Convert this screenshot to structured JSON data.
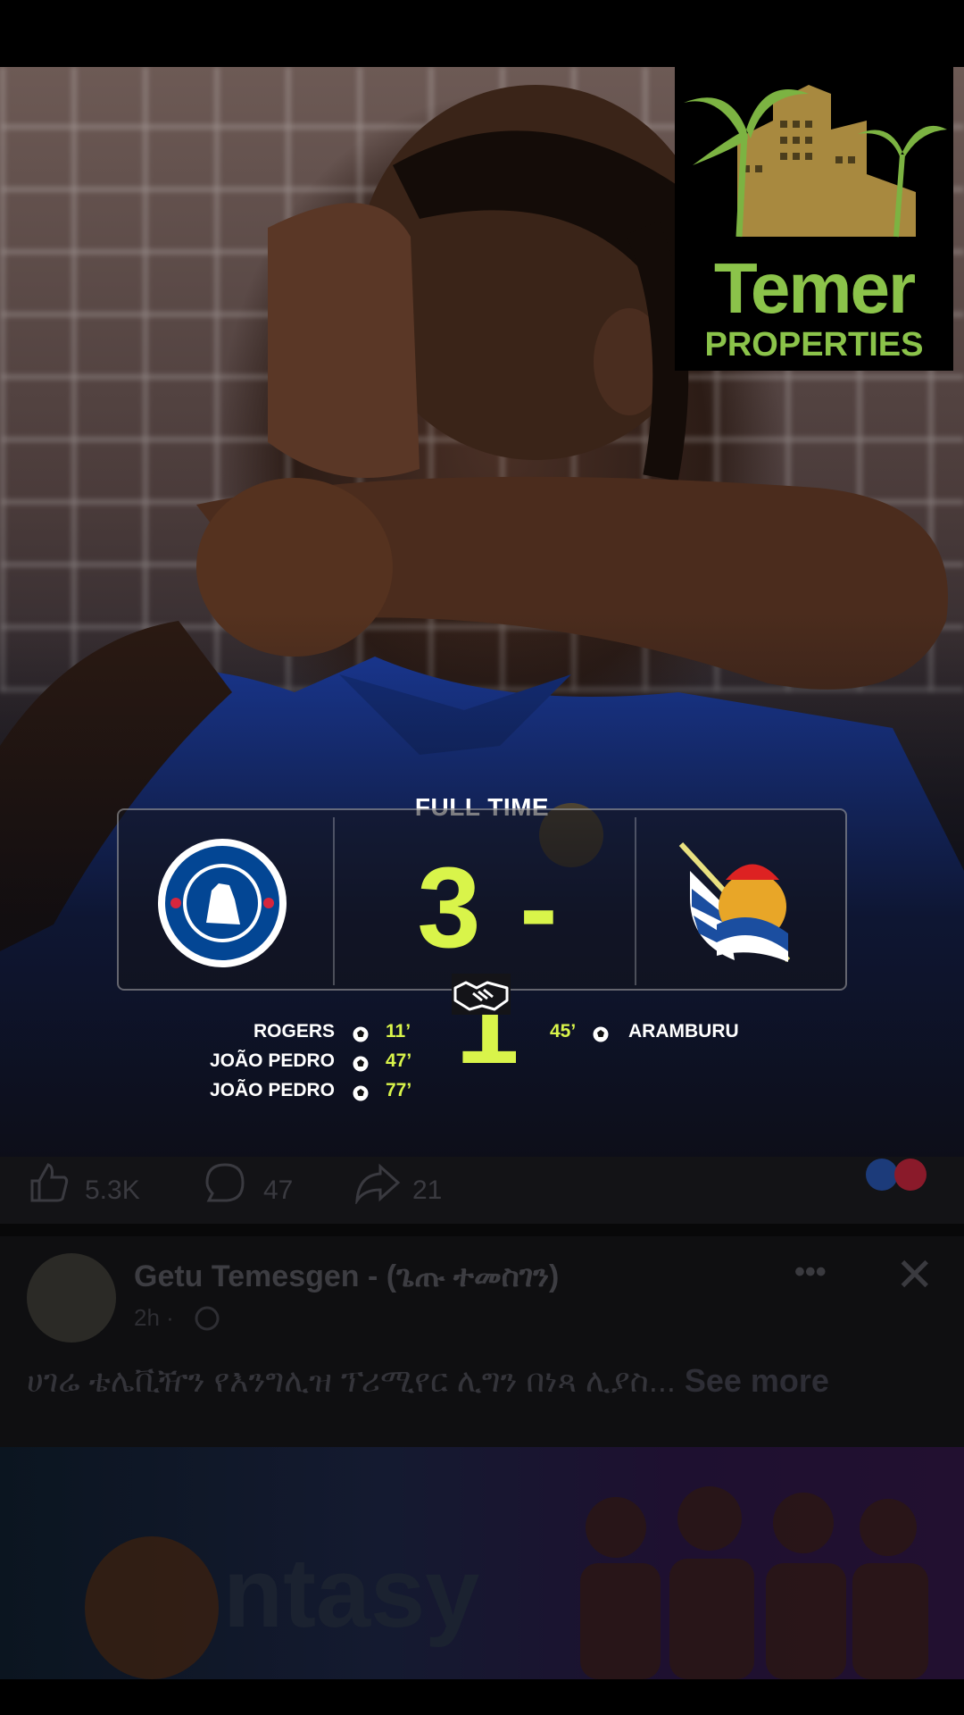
{
  "logo": {
    "word1": "Temer",
    "word2": "PROPERTIES"
  },
  "match": {
    "status": "FULL TIME",
    "score": "3 - 1",
    "home_team": "Chelsea",
    "away_team": "Real Sociedad",
    "home_goals": [
      {
        "scorer": "ROGERS",
        "minute": "11’"
      },
      {
        "scorer": "JOÃO PEDRO",
        "minute": "47’"
      },
      {
        "scorer": "JOÃO PEDRO",
        "minute": "77’"
      }
    ],
    "away_goals": [
      {
        "scorer": "ARAMBURU",
        "minute": "45’"
      }
    ]
  },
  "reactions": {
    "likes": "5.3K",
    "comments": "47",
    "shares": "21"
  },
  "post": {
    "author": "Getu Temesgen - (ጌጡ ተመስገን)",
    "time": "2h ·",
    "text": "ሀገሬ ቴሌቪዥን የእንግሊዝ ፕሪሚየር ሊግን በነጻ ሊያስ...",
    "see_more": "See more"
  },
  "banner": {
    "word": "ntasy"
  },
  "colors": {
    "accent": "#d9f44a",
    "logo_green": "#8bc34a",
    "logo_gold": "#a8893f"
  }
}
